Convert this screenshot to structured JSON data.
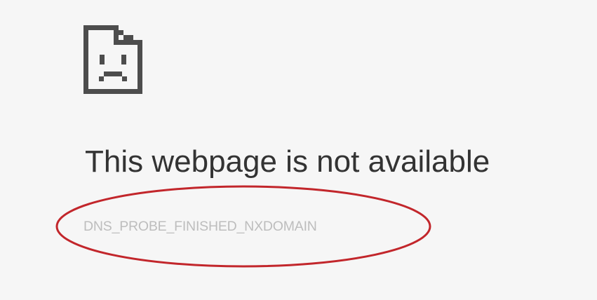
{
  "error": {
    "icon": "sad-page-icon",
    "title": "This webpage is not available",
    "code": "DNS_PROBE_FINISHED_NXDOMAIN"
  },
  "colors": {
    "background": "#f6f6f6",
    "title": "#333333",
    "code": "#bdbdbd",
    "icon": "#4d4d4d",
    "highlight": "#c2262b"
  }
}
